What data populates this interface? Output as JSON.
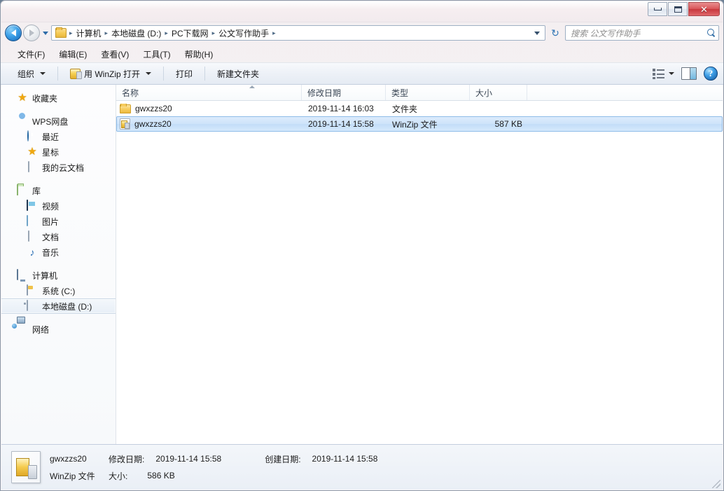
{
  "window": {
    "controls": {
      "minimize": "最小化",
      "maximize": "最大化",
      "close": "✕"
    }
  },
  "address": {
    "back_title": "后退",
    "forward_title": "前进",
    "recent_title": "最近浏览的位置",
    "breadcrumbs": [
      "计算机",
      "本地磁盘 (D:)",
      "PC下载网",
      "公文写作助手"
    ],
    "separator": "▸",
    "refresh": "↻"
  },
  "search": {
    "placeholder": "搜索 公文写作助手",
    "icon": "search-icon"
  },
  "menu": {
    "items": [
      {
        "label": "文件(F)"
      },
      {
        "label": "编辑(E)"
      },
      {
        "label": "查看(V)"
      },
      {
        "label": "工具(T)"
      },
      {
        "label": "帮助(H)"
      }
    ]
  },
  "toolbar": {
    "organize": "组织",
    "open_with": "用 WinZip 打开",
    "print": "打印",
    "new_folder": "新建文件夹",
    "view_mode_title": "更改您的视图",
    "preview_pane_title": "显示预览窗格",
    "help": "?"
  },
  "sidebar": {
    "groups": [
      {
        "items": [
          {
            "label": "收藏夹",
            "icon": "star-icon",
            "level": "top",
            "selected": false
          }
        ]
      },
      {
        "items": [
          {
            "label": "WPS网盘",
            "icon": "cloud-icon",
            "level": "top",
            "selected": false
          },
          {
            "label": "最近",
            "icon": "clock-icon",
            "level": "child",
            "selected": false
          },
          {
            "label": "星标",
            "icon": "star-icon",
            "level": "child",
            "selected": false
          },
          {
            "label": "我的云文档",
            "icon": "document-icon",
            "level": "child",
            "selected": false
          }
        ]
      },
      {
        "items": [
          {
            "label": "库",
            "icon": "library-icon",
            "level": "top",
            "selected": false
          },
          {
            "label": "视频",
            "icon": "video-icon",
            "level": "child",
            "selected": false
          },
          {
            "label": "图片",
            "icon": "picture-icon",
            "level": "child",
            "selected": false
          },
          {
            "label": "文档",
            "icon": "document-icon",
            "level": "child",
            "selected": false
          },
          {
            "label": "音乐",
            "icon": "music-icon",
            "level": "child",
            "selected": false
          }
        ]
      },
      {
        "items": [
          {
            "label": "计算机",
            "icon": "computer-icon",
            "level": "top",
            "selected": false
          },
          {
            "label": "系统 (C:)",
            "icon": "system-drive-icon",
            "level": "child",
            "selected": false
          },
          {
            "label": "本地磁盘 (D:)",
            "icon": "drive-icon",
            "level": "child",
            "selected": true
          }
        ]
      },
      {
        "items": [
          {
            "label": "网络",
            "icon": "network-icon",
            "level": "top",
            "selected": false
          }
        ]
      }
    ]
  },
  "filelist": {
    "columns": [
      {
        "key": "name",
        "label": "名称",
        "sorted": true,
        "sort_direction": "asc"
      },
      {
        "key": "date",
        "label": "修改日期"
      },
      {
        "key": "type",
        "label": "类型"
      },
      {
        "key": "size",
        "label": "大小"
      }
    ],
    "rows": [
      {
        "name": "gwxzzs20",
        "date": "2019-11-14 16:03",
        "type": "文件夹",
        "size": "",
        "icon": "folder-icon",
        "selected": false
      },
      {
        "name": "gwxzzs20",
        "date": "2019-11-14 15:58",
        "type": "WinZip 文件",
        "size": "587 KB",
        "icon": "zip-file-icon",
        "selected": true
      }
    ]
  },
  "statusbar": {
    "name": "gwxzzs20",
    "type": "WinZip 文件",
    "modified_label": "修改日期:",
    "modified_value": "2019-11-14 15:58",
    "created_label": "创建日期:",
    "created_value": "2019-11-14 15:58",
    "size_label": "大小:",
    "size_value": "586 KB"
  },
  "colors": {
    "selection_border": "#8fbce8",
    "selection_fill": "#cfe4fa",
    "close_button": "#c8373d",
    "accent_blue": "#2f6ca5"
  }
}
